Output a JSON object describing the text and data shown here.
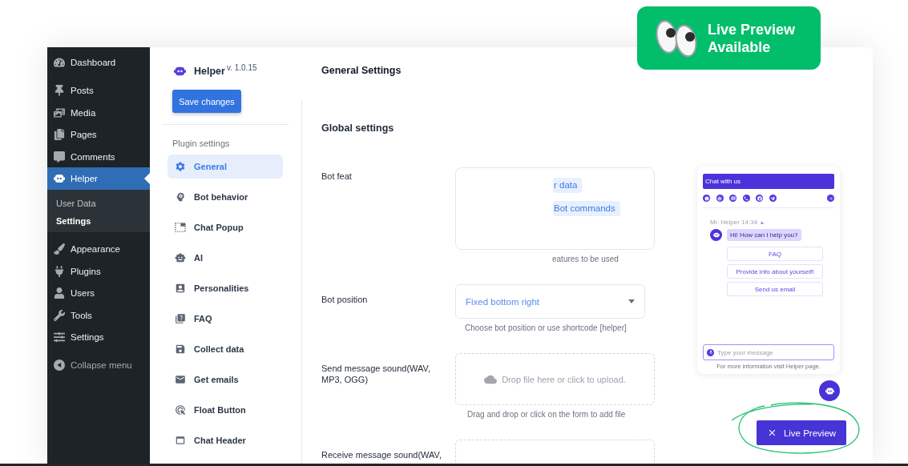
{
  "badge": {
    "text": "Live Preview Available"
  },
  "wp_menu": {
    "groups": [
      {
        "items": [
          {
            "label": "Dashboard",
            "selected": false
          }
        ]
      },
      {
        "items": [
          {
            "label": "Posts",
            "selected": false
          },
          {
            "label": "Media",
            "selected": false
          },
          {
            "label": "Pages",
            "selected": false
          },
          {
            "label": "Comments",
            "selected": false
          },
          {
            "label": "Helper",
            "selected": true,
            "submenu": [
              {
                "label": "User Data",
                "selected": false
              },
              {
                "label": "Settings",
                "selected": true
              }
            ]
          }
        ]
      },
      {
        "items": [
          {
            "label": "Appearance",
            "selected": false
          },
          {
            "label": "Plugins",
            "selected": false
          },
          {
            "label": "Users",
            "selected": false
          },
          {
            "label": "Tools",
            "selected": false
          },
          {
            "label": "Settings",
            "selected": false
          }
        ]
      }
    ],
    "collapse": "Collapse menu"
  },
  "plugin": {
    "name": "Helper",
    "version": "v. 1.0.15",
    "save_button": "Save changes",
    "nav_heading": "Plugin settings",
    "nav": [
      {
        "label": "General",
        "selected": true
      },
      {
        "label": "Bot behavior",
        "selected": false
      },
      {
        "label": "Chat Popup",
        "selected": false
      },
      {
        "label": "AI",
        "selected": false
      },
      {
        "label": "Personalities",
        "selected": false
      },
      {
        "label": "FAQ",
        "selected": false
      },
      {
        "label": "Collect data",
        "selected": false
      },
      {
        "label": "Get emails",
        "selected": false
      },
      {
        "label": "Float Button",
        "selected": false
      },
      {
        "label": "Chat Header",
        "selected": false
      }
    ]
  },
  "settings": {
    "title": "General Settings",
    "section": "Global settings",
    "fields": [
      {
        "kind": "tags",
        "label": "Bot feat",
        "tags": [
          "r data",
          "Bot commands"
        ],
        "help": "eatures to be used"
      },
      {
        "kind": "select",
        "label": "Bot position",
        "value": "Fixed bottom right",
        "help": "Choose bot position or use shortcode [helper]"
      },
      {
        "kind": "upload",
        "label": "Send message sound(WAV, MP3, OGG)",
        "prompt": "Drop file here or click to upload.",
        "help": "Drag and drop or click on the form to add file"
      },
      {
        "kind": "upload",
        "label": "Receive message sound(WAV,"
      }
    ]
  },
  "preview": {
    "header": "Chat with us",
    "sender": "Mr. Helper 14:34",
    "message": "Hi! How can I help you?",
    "options": [
      "FAQ",
      "Provide info about yourself!",
      "Send us email"
    ],
    "input": {
      "placeholder": "Type your message"
    },
    "footer": "For more information visit Helper page.",
    "button": "Live Preview"
  }
}
